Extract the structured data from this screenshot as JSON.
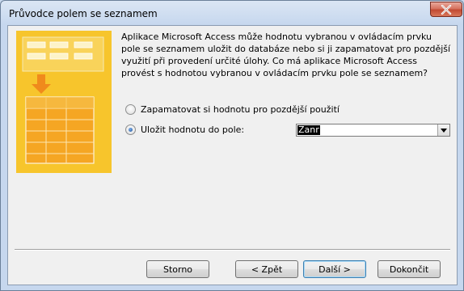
{
  "window": {
    "title": "Průvodce polem se seznamem"
  },
  "message": "Aplikace Microsoft Access může hodnotu vybranou v ovládacím prvku pole se seznamem uložit do databáze nebo si ji zapamatovat pro pozdější využití při provedení určité úlohy. Co má aplikace Microsoft Access provést s hodnotou vybranou v ovládacím prvku pole se seznamem?",
  "options": [
    {
      "label": "Zapamatovat si hodnotu pro pozdější použití",
      "checked": false
    },
    {
      "label": "Uložit hodnotu do pole:",
      "checked": true
    }
  ],
  "field_combo": {
    "value": "Zanr"
  },
  "buttons": {
    "cancel": "Storno",
    "back": "< Zpět",
    "next": "Další >",
    "finish": "Dokončit"
  },
  "colors": {
    "art_background": "#f7c52c",
    "art_arrow": "#f08a1c",
    "art_grid": "#f5a623"
  },
  "icons": {
    "close": "close-icon",
    "dropdown": "chevron-down-icon",
    "wizard_art": "table-wizard-illustration"
  }
}
